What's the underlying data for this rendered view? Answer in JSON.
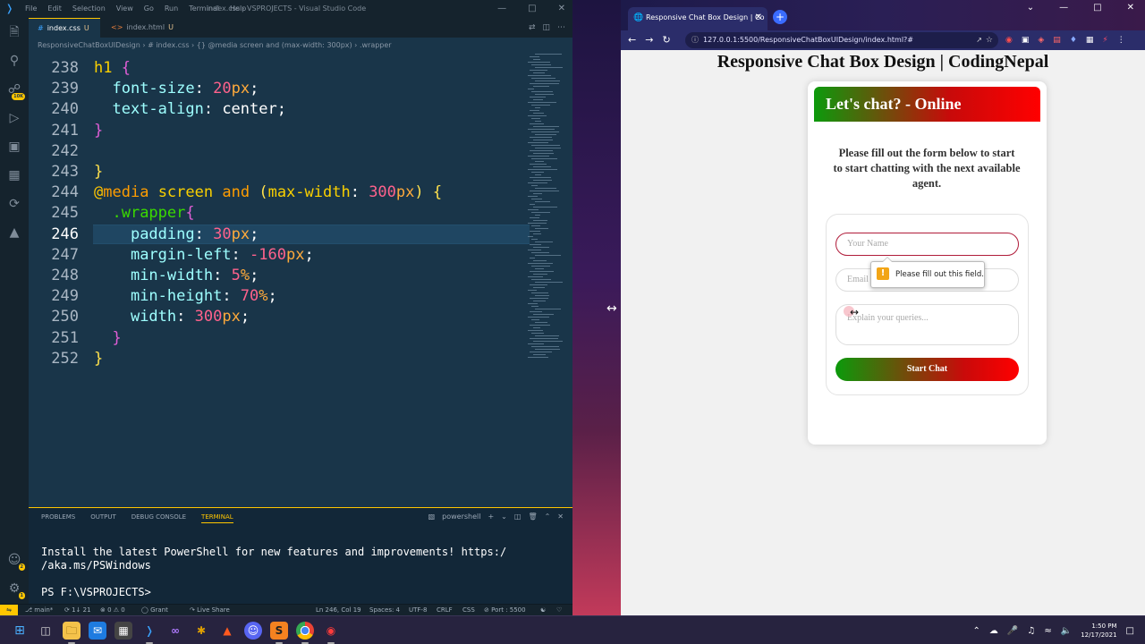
{
  "vscode": {
    "window_title": "index.css - VSPROJECTS - Visual Studio Code",
    "menu": [
      "File",
      "Edit",
      "Selection",
      "View",
      "Go",
      "Run",
      "Terminal",
      "Help"
    ],
    "activity_badges": {
      "source_control": "10K",
      "accounts": "2",
      "settings": "1"
    },
    "tabs": [
      {
        "label": "index.css",
        "status": "U",
        "icon": "css-icon"
      },
      {
        "label": "index.html",
        "status": "U",
        "icon": "html-icon"
      }
    ],
    "breadcrumb": [
      "ResponsiveChatBoxUIDesign",
      "# index.css",
      "{} @media screen and (max-width: 300px)",
      ".wrapper"
    ],
    "lines": [
      {
        "num": "238",
        "html": "<span class='sel'>h1 </span><span class='brk'>{</span>"
      },
      {
        "num": "239",
        "html": "  <span class='prop'>font-size</span><span class='wh'>: </span><span class='num'>20</span><span class='unit'>px</span><span class='wh'>;</span>"
      },
      {
        "num": "240",
        "html": "  <span class='prop'>text-align</span><span class='wh'>: center;</span>"
      },
      {
        "num": "241",
        "html": "<span class='brk'>}</span>"
      },
      {
        "num": "242",
        "html": ""
      },
      {
        "num": "243",
        "html": "<span class='br2'>}</span>"
      },
      {
        "num": "244",
        "html": "<span class='at'>@</span><span class='kw'>media</span><span class='wh'> </span><span class='sel'>screen</span><span class='wh'> </span><span class='kw'>and</span><span class='wh'> </span><span class='br2'>(</span><span class='sel'>max-width</span><span class='wh'>: </span><span class='num'>300</span><span class='unit'>px</span><span class='br2'>) {</span>"
      },
      {
        "num": "245",
        "html": "  <span class='cls'>.wrapper</span><span class='brk'>{</span>"
      },
      {
        "num": "246",
        "html": "    <span class='prop'>padding</span><span class='wh'>: </span><span class='num'>30</span><span class='unit'>px</span><span class='wh'>;</span>"
      },
      {
        "num": "247",
        "html": "    <span class='prop'>margin-left</span><span class='wh'>: </span><span class='num'>-160</span><span class='unit'>px</span><span class='wh'>;</span>"
      },
      {
        "num": "248",
        "html": "    <span class='prop'>min-width</span><span class='wh'>: </span><span class='num'>5</span><span class='unit'>%</span><span class='wh'>;</span>"
      },
      {
        "num": "249",
        "html": "    <span class='prop'>min-height</span><span class='wh'>: </span><span class='num'>70</span><span class='unit'>%</span><span class='wh'>;</span>"
      },
      {
        "num": "250",
        "html": "    <span class='prop'>width</span><span class='wh'>: </span><span class='num'>300</span><span class='unit'>px</span><span class='wh'>;</span>"
      },
      {
        "num": "251",
        "html": "  <span class='brk'>}</span>"
      },
      {
        "num": "252",
        "html": "<span class='br2'>}</span>"
      }
    ],
    "current_line": "246",
    "panel_tabs": [
      "PROBLEMS",
      "OUTPUT",
      "DEBUG CONSOLE",
      "TERMINAL"
    ],
    "active_panel_tab": "TERMINAL",
    "terminal_shell": "powershell",
    "terminal_text": "Install the latest PowerShell for new features and improvements! https:/\n/aka.ms/PSWindows\n\nPS F:\\VSPROJECTS> ",
    "status": {
      "branch": "main*",
      "sync": "1↓ 21",
      "problems": "⊗ 0 ⚠ 0",
      "user": "Grant",
      "live_share": "Live Share",
      "position": "Ln 246, Col 19",
      "spaces": "Spaces: 4",
      "encoding": "UTF-8",
      "eol": "CRLF",
      "language": "CSS",
      "port": "Port : 5500"
    }
  },
  "chrome": {
    "tab_title": "Responsive Chat Box Design | Co",
    "url": "127.0.0.1:5500/ResponsiveChatBoxUIDesign/index.html?#"
  },
  "page": {
    "heading": "Responsive Chat Box Design | CodingNepal",
    "chat_header": "Let's chat? - Online",
    "chat_text": "Please fill out the form below to start to start chatting with the next available agent.",
    "name_placeholder": "Your Name",
    "email_placeholder": "Email",
    "query_placeholder": "Explain your queries...",
    "button": "Start Chat",
    "tooltip": "Please fill out this field."
  },
  "taskbar": {
    "time": "1:50 PM",
    "date": "12/17/2021"
  },
  "colors": {
    "editor_bg": "#193549",
    "accent": "#ffc600",
    "chat_gradient_start": "#0c9a0c",
    "chat_gradient_end": "#ff0000"
  }
}
